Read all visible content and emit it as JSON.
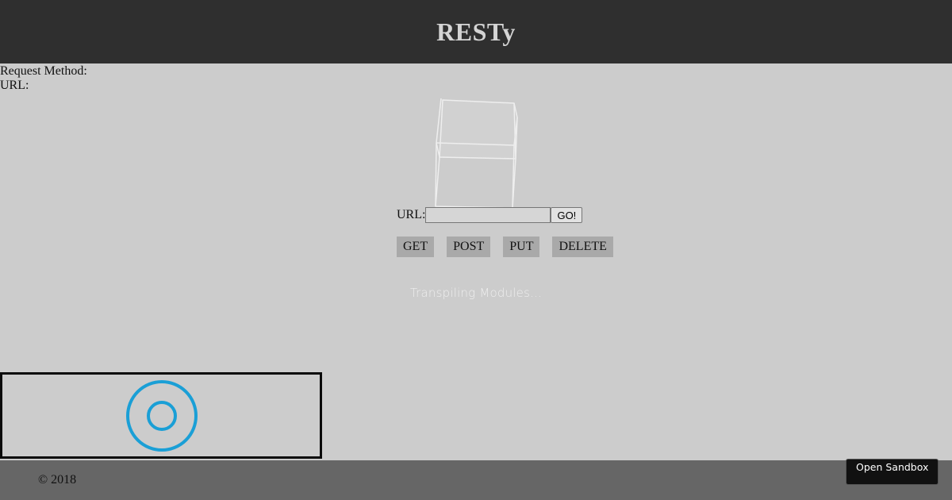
{
  "header": {
    "title": "RESTy"
  },
  "request_info": {
    "method_label": "Request Method:",
    "url_label": "URL:"
  },
  "form": {
    "url_label": "URL:",
    "url_value": "",
    "go_label": "GO!"
  },
  "methods": [
    "GET",
    "POST",
    "PUT",
    "DELETE"
  ],
  "status": {
    "text": "Transpiling Modules..."
  },
  "loader": {
    "icon": "spinner-rings-icon",
    "color": "#1a9fd6"
  },
  "cube": {
    "icon": "cube-icon",
    "color": "#f2f2f2"
  },
  "footer": {
    "copyright": "© 2018"
  },
  "sandbox_button": {
    "label": "Open Sandbox"
  },
  "colors": {
    "header_bg": "#2f2f2f",
    "page_bg": "#cccccc",
    "footer_bg": "#666666",
    "method_bg": "#a9a9a9"
  }
}
